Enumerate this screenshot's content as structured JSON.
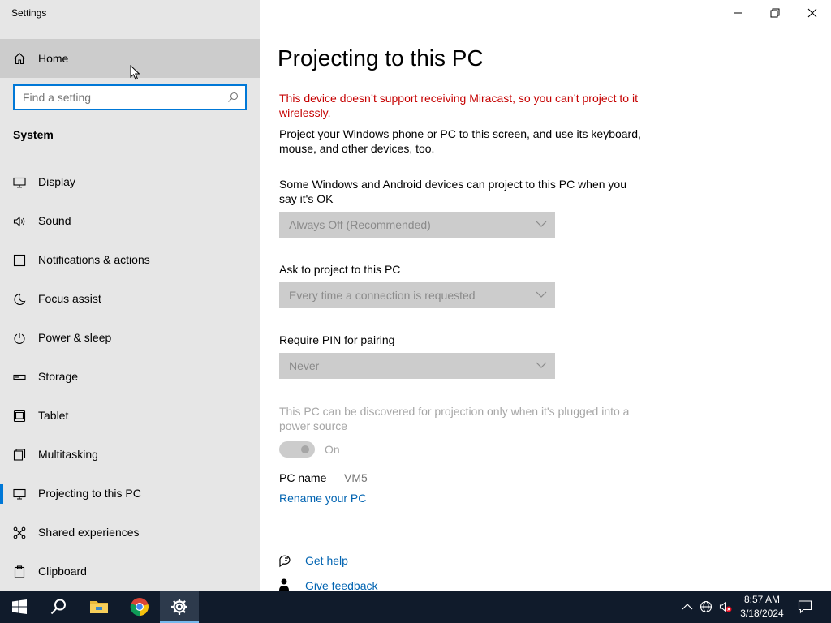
{
  "window": {
    "title": "Settings",
    "controls": {
      "minimize": "minimize",
      "restore": "restore",
      "close": "close"
    }
  },
  "sidebar": {
    "home_label": "Home",
    "search": {
      "placeholder": "Find a setting",
      "value": ""
    },
    "section_label": "System",
    "items": [
      {
        "label": "Display",
        "icon": "monitor-icon"
      },
      {
        "label": "Sound",
        "icon": "speaker-icon"
      },
      {
        "label": "Notifications & actions",
        "icon": "notification-icon"
      },
      {
        "label": "Focus assist",
        "icon": "moon-icon"
      },
      {
        "label": "Power & sleep",
        "icon": "power-icon"
      },
      {
        "label": "Storage",
        "icon": "storage-icon"
      },
      {
        "label": "Tablet",
        "icon": "tablet-icon"
      },
      {
        "label": "Multitasking",
        "icon": "multitasking-icon"
      },
      {
        "label": "Projecting to this PC",
        "icon": "projecting-icon",
        "selected": true
      },
      {
        "label": "Shared experiences",
        "icon": "shared-experiences-icon"
      },
      {
        "label": "Clipboard",
        "icon": "clipboard-icon"
      }
    ]
  },
  "main": {
    "title": "Projecting to this PC",
    "warning": "This device doesn’t support receiving Miracast, so you can’t project to it wirelessly.",
    "description": "Project your Windows phone or PC to this screen, and use its keyboard, mouse, and other devices, too.",
    "setting1": {
      "label": "Some Windows and Android devices can project to this PC when you say it's OK",
      "value": "Always Off (Recommended)"
    },
    "setting2": {
      "label": "Ask to project to this PC",
      "value": "Every time a connection is requested"
    },
    "setting3": {
      "label": "Require PIN for pairing",
      "value": "Never"
    },
    "plugged_note": "This PC can be discovered for projection only when it's plugged into a power source",
    "toggle_state": "On",
    "pc_name_label": "PC name",
    "pc_name_value": "VM5",
    "rename_link": "Rename your PC",
    "get_help": "Get help",
    "give_feedback": "Give feedback"
  },
  "taskbar": {
    "clock_time": "8:57 AM",
    "clock_date": "3/18/2024",
    "accent": "#76b9ed"
  },
  "colors": {
    "accent": "#0078d7",
    "warning": "#c50000",
    "link": "#0063b1"
  }
}
